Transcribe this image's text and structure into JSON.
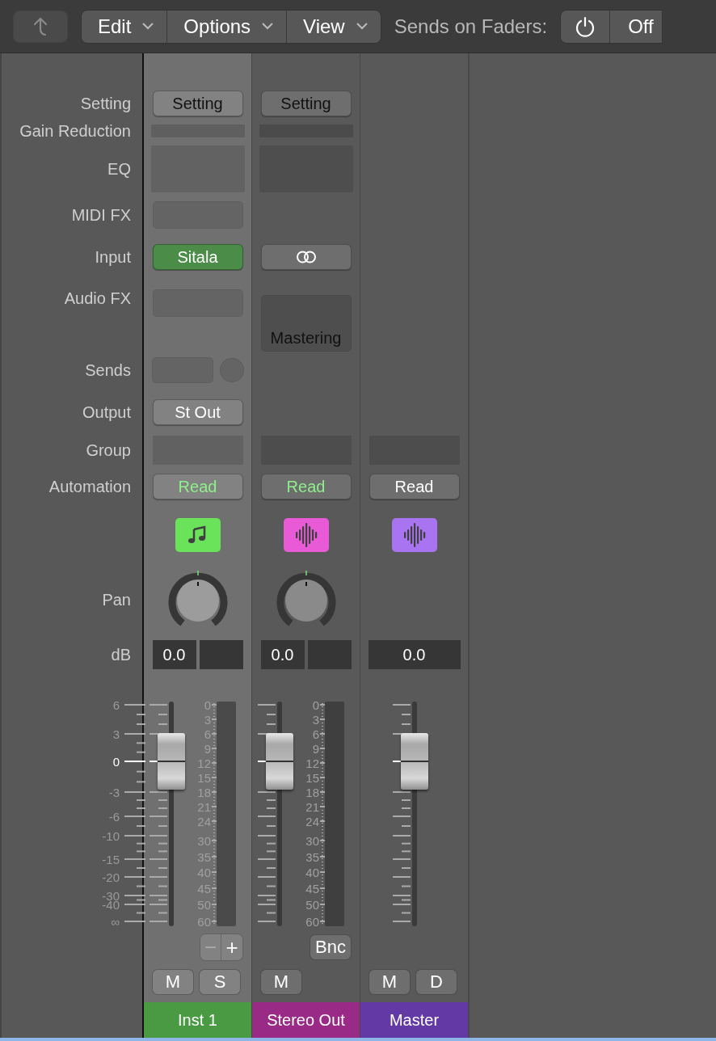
{
  "toolbar": {
    "menus": [
      {
        "label": "Edit"
      },
      {
        "label": "Options"
      },
      {
        "label": "View"
      }
    ],
    "sends_label": "Sends on Faders:",
    "sends_state": "Off"
  },
  "labels": [
    "Setting",
    "Gain Reduction",
    "EQ",
    "MIDI FX",
    "Input",
    "Audio FX",
    "Sends",
    "Output",
    "Group",
    "Automation",
    "Pan",
    "dB"
  ],
  "fader_scale": [
    "6",
    "3",
    "0",
    "-3",
    "-6",
    "-10",
    "-15",
    "-20",
    "-30",
    "-40",
    "∞"
  ],
  "strips": [
    {
      "name": "Inst 1",
      "color": "#4a9a44",
      "selected": true,
      "setting": "Setting",
      "gain_slot": true,
      "eq_slot": true,
      "midi_fx_slot": true,
      "input": {
        "kind": "plugin",
        "label": "Sitala"
      },
      "audio_fx": {
        "kind": "empty"
      },
      "sends_slot": true,
      "output": "St Out",
      "group_slot": true,
      "automation": {
        "label": "Read",
        "color": "#8ef08a"
      },
      "icon": {
        "kind": "note",
        "color": "#6ae25a"
      },
      "pan_knob": true,
      "db": "0.0",
      "peak_field": true,
      "fader": {
        "level": 0.74
      },
      "meter_scale": [
        "0",
        "3",
        "6",
        "9",
        "12",
        "15",
        "18",
        "21",
        "24",
        "30",
        "35",
        "40",
        "45",
        "50",
        "60"
      ],
      "extra": {
        "kind": "minus_plus",
        "labels": [
          "−",
          "+"
        ]
      },
      "buttons": [
        "M",
        "S"
      ]
    },
    {
      "name": "Stereo Out",
      "color": "#992a86",
      "selected": false,
      "setting": "Setting",
      "gain_slot": true,
      "eq_slot": true,
      "midi_fx_slot": false,
      "input": {
        "kind": "link"
      },
      "audio_fx": {
        "kind": "plugin",
        "label": "Mastering"
      },
      "sends_slot": false,
      "group_slot": true,
      "automation": {
        "label": "Read",
        "color": "#8ef08a"
      },
      "icon": {
        "kind": "wave",
        "color": "#e85ad6"
      },
      "pan_knob": true,
      "db": "0.0",
      "peak_field": true,
      "fader": {
        "level": 0.74
      },
      "meter_scale": [
        "0",
        "3",
        "6",
        "9",
        "12",
        "15",
        "18",
        "21",
        "24",
        "30",
        "35",
        "40",
        "45",
        "50",
        "60"
      ],
      "extra": {
        "kind": "button",
        "labels": [
          "Bnc"
        ]
      },
      "buttons": [
        "M"
      ]
    },
    {
      "name": "Master",
      "color": "#6339a6",
      "selected": false,
      "gain_slot": false,
      "eq_slot": false,
      "midi_fx_slot": false,
      "audio_fx": {
        "kind": "none"
      },
      "sends_slot": false,
      "group_slot": true,
      "automation": {
        "label": "Read",
        "color": "#ffffff"
      },
      "icon": {
        "kind": "wave",
        "color": "#a874f2"
      },
      "pan_knob": false,
      "db": "0.0",
      "peak_field": false,
      "fader": {
        "level": 0.74
      },
      "buttons": [
        "M",
        "D"
      ]
    }
  ]
}
